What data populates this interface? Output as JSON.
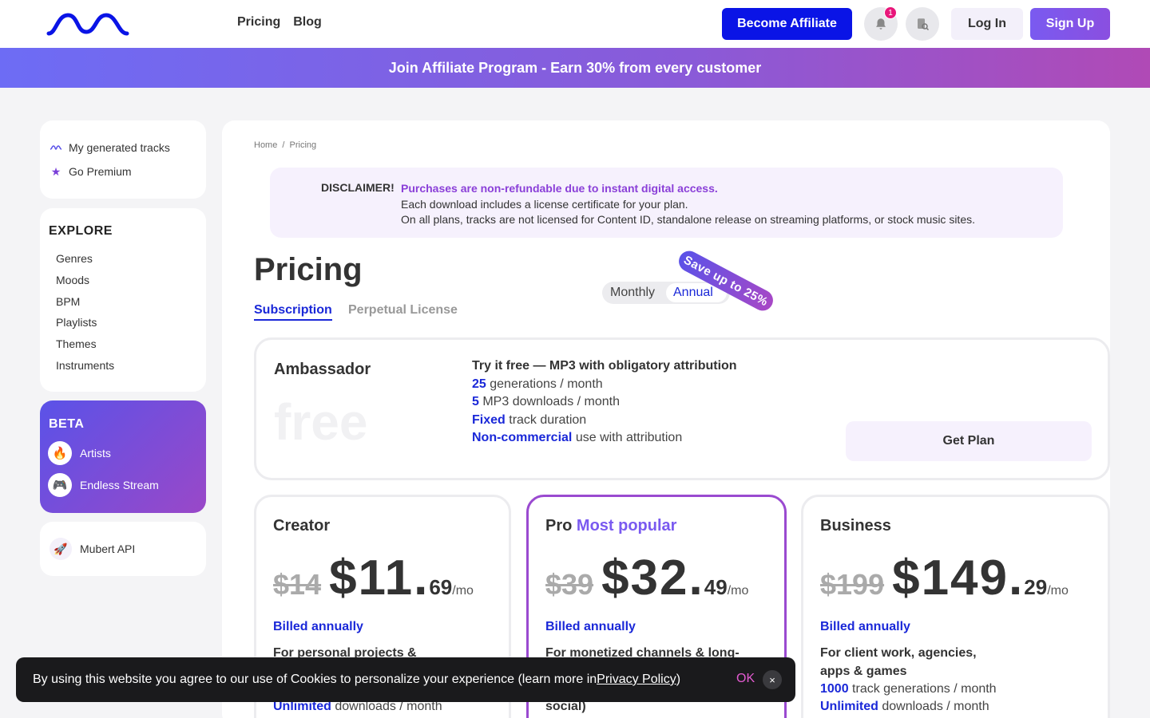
{
  "header": {
    "nav": [
      "Pricing",
      "Blog"
    ],
    "affiliate_label": "Become Affiliate",
    "notification_count": "1",
    "login_label": "Log In",
    "signup_label": "Sign Up"
  },
  "banner": "Join Affiliate Program - Earn 30% from every customer",
  "sidebar": {
    "top": [
      "My generated tracks",
      "Go Premium"
    ],
    "explore_title": "EXPLORE",
    "explore": [
      "Genres",
      "Moods",
      "BPM",
      "Playlists",
      "Themes",
      "Instruments"
    ],
    "beta_title": "BETA",
    "beta": [
      "Artists",
      "Endless Stream"
    ],
    "api": "Mubert API"
  },
  "main": {
    "breadcrumb": [
      "Home",
      "/",
      "Pricing"
    ],
    "disclaimer": {
      "label": "DISCLAIMER!",
      "highlight": "Purchases are non-refundable due to instant digital access.",
      "line2": "Each download includes a license certificate for your plan.",
      "line3": "On all plans, tracks are not licensed for Content ID, standalone release on streaming platforms, or stock music sites."
    },
    "title": "Pricing",
    "tabs": [
      "Subscription",
      "Perpetual License"
    ],
    "toggle": {
      "monthly": "Monthly",
      "annual": "Annual"
    },
    "save_tag": "Save up to 25%",
    "ambassador": {
      "name": "Ambassador",
      "price": "free",
      "headline": "Try it free — MP3 with obligatory attribution",
      "f1_hl": "25",
      "f1": " generations / month",
      "f2_hl": "5",
      "f2": " MP3 downloads / month",
      "f3_hl": "Fixed",
      "f3": " track duration",
      "f4_hl": "Non-commercial",
      "f4": " use with attribution",
      "button": "Get Plan"
    },
    "plans": [
      {
        "name": "Creator",
        "popular": "",
        "old": "$14",
        "whole": "$11",
        "cents": "69",
        "per": "/mo",
        "billed": "Billed annually",
        "desc": "For personal projects &",
        "f1_hl": "Unlimited",
        "f1": " downloads / month"
      },
      {
        "name": "Pro",
        "popular": "Most popular",
        "old": "$39",
        "whole": "$32",
        "cents": "49",
        "per": "/mo",
        "billed": "Billed annually",
        "desc": "For monetized channels & long-",
        "desc_end": "social)"
      },
      {
        "name": "Business",
        "popular": "",
        "old": "$199",
        "whole": "$149",
        "cents": "29",
        "per": "/mo",
        "billed": "Billed annually",
        "desc1": "For client work, agencies,",
        "desc2": "apps & games",
        "f1_hl": "1000",
        "f1": " track generations / month",
        "f2_hl": "Unlimited",
        "f2": " downloads / month"
      }
    ]
  },
  "cookie": {
    "text": "By using this website you agree to our use of Cookies to personalize your experience (learn more in ",
    "link": "Privacy Policy",
    "end": ")",
    "ok": "OK",
    "close": "×"
  },
  "colors": {
    "brand_blue": "#0a14e6",
    "accent_purple": "#7a5af0",
    "pink": "#e8167a"
  }
}
